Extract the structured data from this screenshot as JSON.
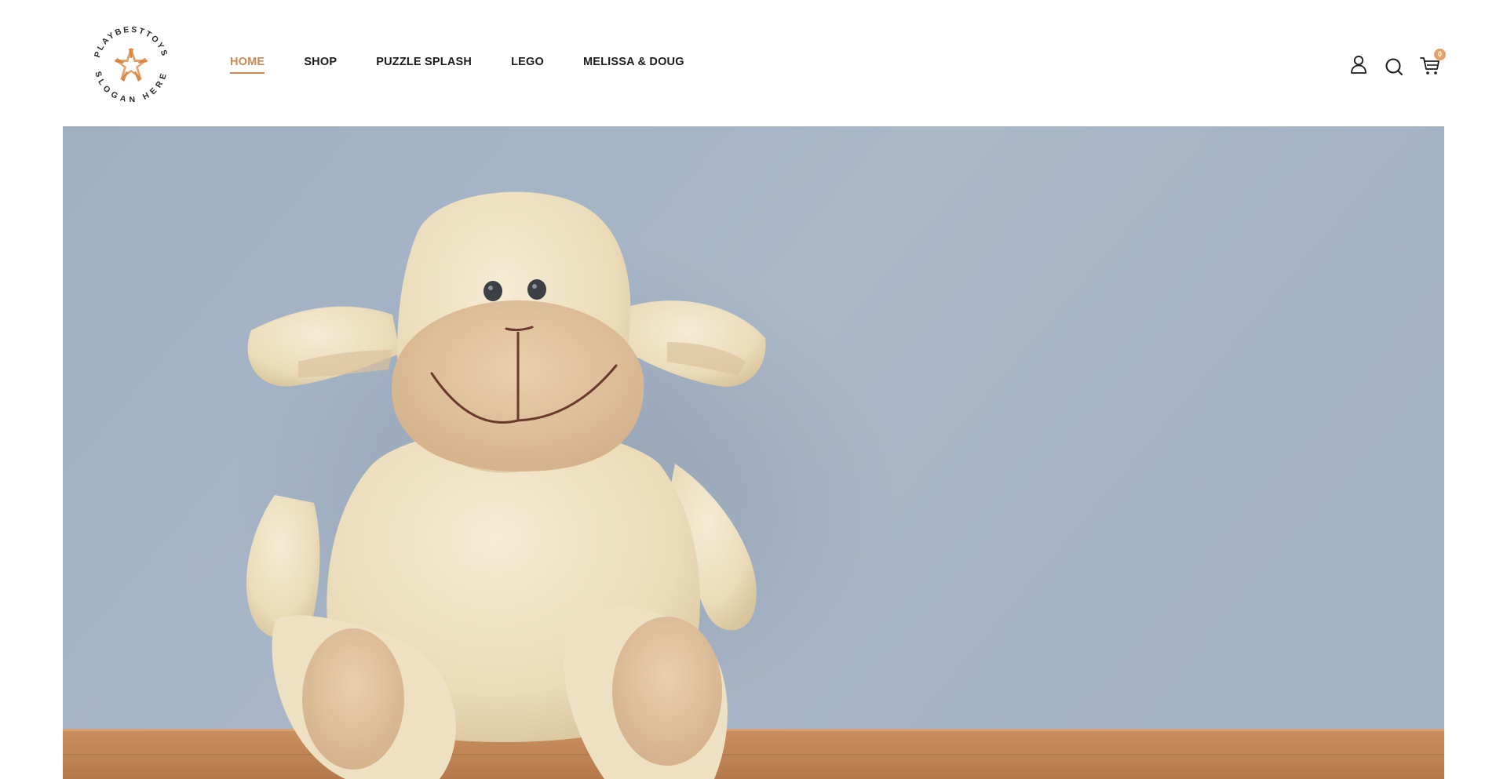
{
  "brand": {
    "arc_top": "PLAYBESTTOYS",
    "arc_bottom": "SLOGAN HERE",
    "accent_color": "#e3a36d"
  },
  "nav": {
    "items": [
      {
        "label": "HOME",
        "active": true
      },
      {
        "label": "SHOP",
        "active": false
      },
      {
        "label": "PUZZLE SPLASH",
        "active": false
      },
      {
        "label": "LEGO",
        "active": false
      },
      {
        "label": "MELISSA & DOUG",
        "active": false
      }
    ]
  },
  "header_actions": {
    "account_icon": "user-icon",
    "search_icon": "search-icon",
    "cart_icon": "cart-icon",
    "cart_count": "0"
  },
  "hero": {
    "image": "plush-sheep-toy-on-wooden-shelf",
    "colors": {
      "wall": "#a7b5c5",
      "shelf": "#c1875a",
      "toy": "#efe2c4",
      "muzzle": "#dfc09b"
    }
  }
}
